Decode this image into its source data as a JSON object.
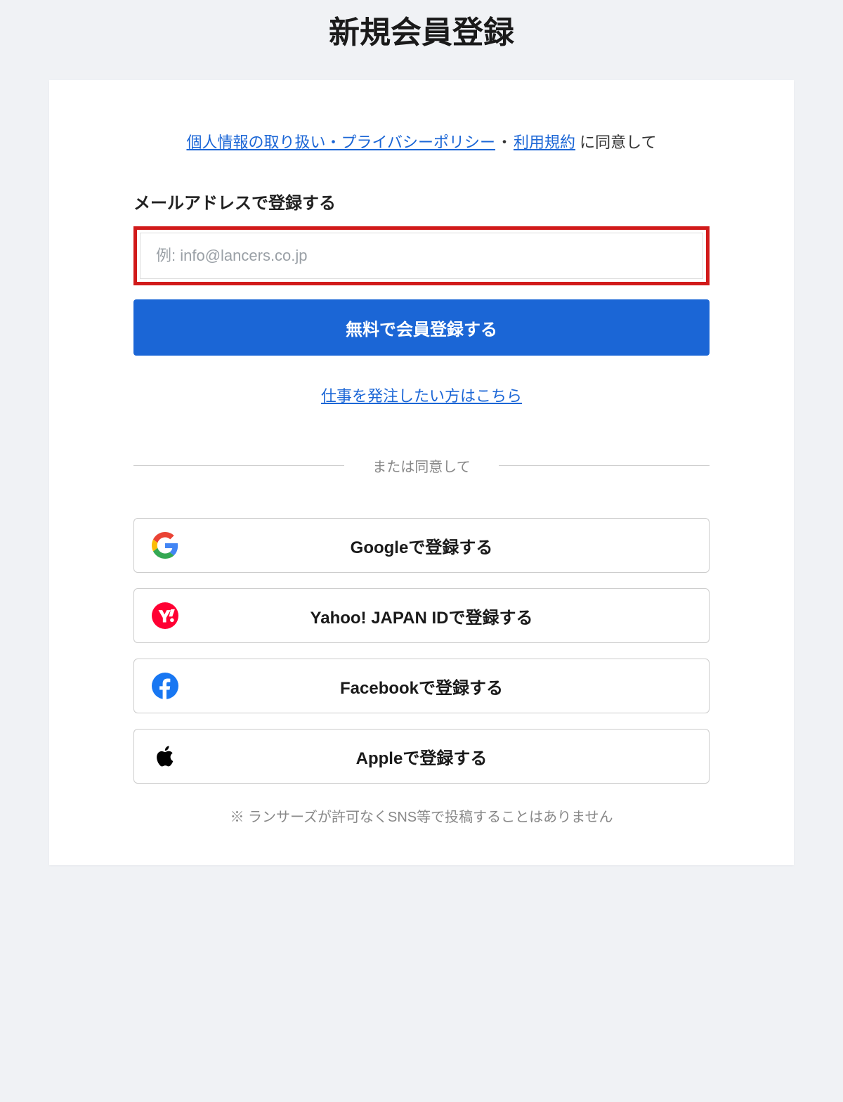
{
  "page_title": "新規会員登録",
  "consent": {
    "privacy_link": "個人情報の取り扱い・プライバシーポリシー",
    "separator": "・",
    "terms_link": "利用規約",
    "suffix": " に同意して"
  },
  "email_section": {
    "heading": "メールアドレスで登録する",
    "placeholder": "例: info@lancers.co.jp",
    "value": ""
  },
  "primary_button_label": "無料で会員登録する",
  "client_link_label": "仕事を発注したい方はこちら",
  "divider_label": "または同意して",
  "social": {
    "google": "Googleで登録する",
    "yahoo": "Yahoo! JAPAN IDで登録する",
    "facebook": "Facebookで登録する",
    "apple": "Appleで登録する"
  },
  "disclaimer": "※ ランサーズが許可なくSNS等で投稿することはありません"
}
